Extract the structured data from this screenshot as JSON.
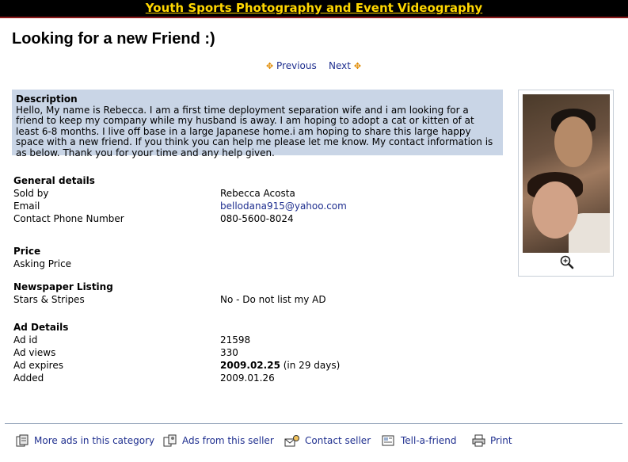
{
  "banner": {
    "title": "Youth Sports Photography and Event Videography"
  },
  "page": {
    "title": "Looking for a new Friend :)"
  },
  "nav": {
    "previous": "Previous",
    "next": "Next"
  },
  "description": {
    "heading": "Description",
    "text": "Hello, My name is Rebecca. I am a first time deployment separation wife and i am looking for a friend to keep my company while my husband is away. I am hoping to adopt a cat or kitten of at least 6-8 months. I live off base in a large Japanese home.i am hoping to share this large happy space with a new friend. If you think you can help me please let me know. My contact information is as below. Thank you for your time and any help given."
  },
  "general": {
    "heading": "General details",
    "sold_by_label": "Sold by",
    "sold_by": "Rebecca Acosta",
    "email_label": "Email",
    "email": "bellodana915@yahoo.com",
    "phone_label": "Contact Phone Number",
    "phone": "080-5600-8024"
  },
  "price": {
    "heading": "Price",
    "asking_label": "Asking Price"
  },
  "newspaper": {
    "heading": "Newspaper Listing",
    "stars_label": "Stars & Stripes",
    "stars_value": "No - Do not list my AD"
  },
  "ad_details": {
    "heading": "Ad Details",
    "id_label": "Ad id",
    "id": "21598",
    "views_label": "Ad views",
    "views": "330",
    "expires_label": "Ad expires",
    "expires_date": "2009.02.25",
    "expires_note": "(in 29 days)",
    "added_label": "Added",
    "added": "2009.01.26"
  },
  "footer": {
    "more_ads": "More ads in this category",
    "seller_ads": "Ads from this seller",
    "contact": "Contact seller",
    "tell": "Tell-a-friend",
    "print": "Print"
  },
  "colors": {
    "banner_bg": "#000000",
    "banner_text": "#ffd700",
    "desc_bg": "#c9d5e6",
    "link": "#1f2f8f"
  }
}
